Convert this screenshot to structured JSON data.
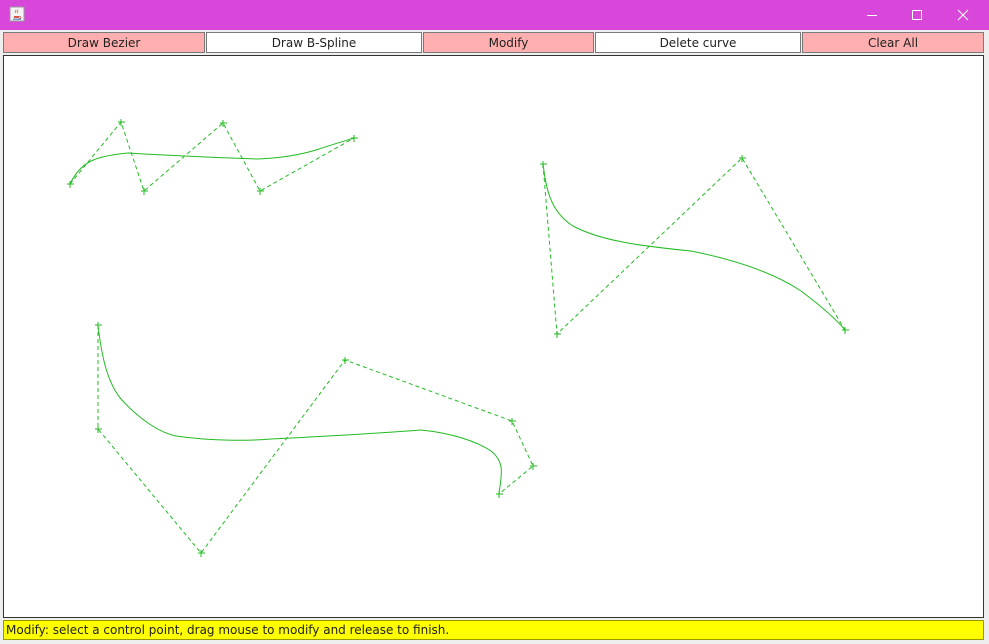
{
  "window": {
    "title": "",
    "colors": {
      "titlebar": "#d946da",
      "button_pink": "#ffafaf",
      "button_white": "#ffffff",
      "status_bg": "#ffff00",
      "curve": "#22bb22"
    }
  },
  "toolbar": {
    "buttons": [
      {
        "id": "draw-bezier",
        "label": "Draw Bezier",
        "style": "pink"
      },
      {
        "id": "draw-bspline",
        "label": "Draw B-Spline",
        "style": "white"
      },
      {
        "id": "modify",
        "label": "Modify",
        "style": "pink"
      },
      {
        "id": "delete-curve",
        "label": "Delete curve",
        "style": "white"
      },
      {
        "id": "clear-all",
        "label": "Clear All",
        "style": "pink"
      }
    ]
  },
  "status": {
    "text": "Modify: select a control point, drag mouse to modify and release to finish."
  },
  "icons": {
    "app": "java-cup-icon",
    "minimize": "minimize-icon",
    "maximize": "maximize-icon",
    "close": "close-icon"
  }
}
